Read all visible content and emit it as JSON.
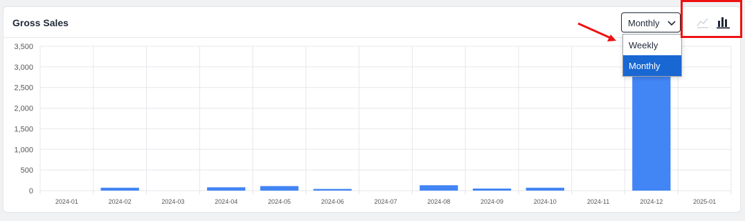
{
  "card": {
    "title": "Gross Sales"
  },
  "period_select": {
    "value": "Monthly",
    "options": [
      "Weekly",
      "Monthly"
    ],
    "selected_index": 1
  },
  "chart_type_toggle": {
    "icons": [
      "line-chart-icon",
      "bar-chart-icon"
    ],
    "active": "bar-chart-icon"
  },
  "colors": {
    "bar": "#4285f4",
    "grid": "#e5e7eb",
    "accent": "#1967d2",
    "annotation": "#ee1111"
  },
  "chart_data": {
    "type": "bar",
    "categories": [
      "2024-01",
      "2024-02",
      "2024-03",
      "2024-04",
      "2024-05",
      "2024-06",
      "2024-07",
      "2024-08",
      "2024-09",
      "2024-10",
      "2024-11",
      "2024-12",
      "2025-01"
    ],
    "values": [
      0,
      70,
      0,
      80,
      110,
      40,
      0,
      130,
      50,
      70,
      0,
      2900,
      0
    ],
    "ylim": [
      0,
      3500
    ],
    "yticks": [
      "0",
      "500",
      "1,000",
      "1,500",
      "2,000",
      "2,500",
      "3,000",
      "3,500"
    ],
    "title": "",
    "xlabel": "",
    "ylabel": "",
    "grid": true
  }
}
